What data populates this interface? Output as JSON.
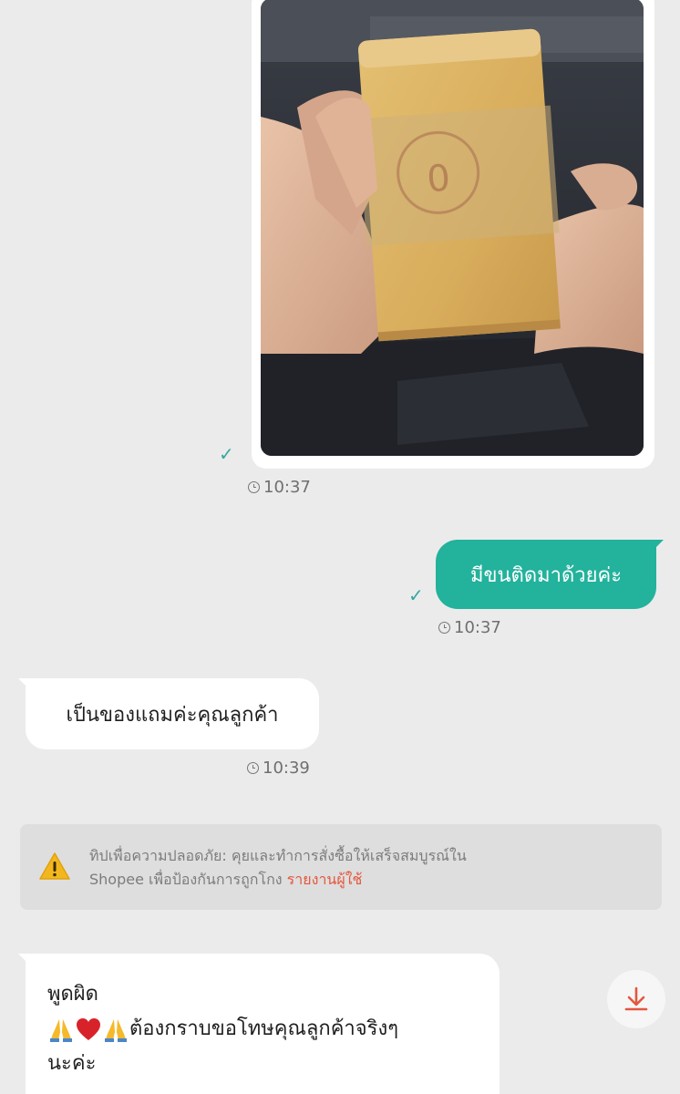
{
  "messages": {
    "image_message": {
      "time": "10:37",
      "status_icon": "check-icon"
    },
    "outgoing_text": {
      "text": "มีขนติดมาด้วยค่ะ",
      "time": "10:37",
      "status_icon": "check-icon"
    },
    "incoming_text_1": {
      "text": "เป็นของแถมค่ะคุณลูกค้า",
      "time": "10:39"
    },
    "incoming_text_2": {
      "line1": "พูดผิด",
      "line2": "ต้องกราบขอโทษคุณลูกค้าจริงๆ",
      "line3": "นะค่ะ",
      "emojis": [
        "folded-hands-icon",
        "red-heart-icon",
        "folded-hands-icon"
      ]
    }
  },
  "safety_tip": {
    "line1": "ทิปเพื่อความปลอดภัย: คุยและทำการสั่งซื้อให้เสร็จสมบูรณ์ใน",
    "line2": "Shopee เพื่อป้องกันการถูกโกง",
    "report_link": "รายงานผู้ใช้",
    "icon": "warning-icon"
  },
  "download_icon": "download-icon",
  "colors": {
    "background": "#ebebeb",
    "outgoing_bubble": "#23b29c",
    "incoming_bubble": "#ffffff",
    "check": "#35a89f",
    "link": "#e4573d",
    "warning": "#f3b71e"
  }
}
